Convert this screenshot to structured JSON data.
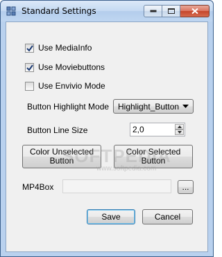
{
  "window": {
    "title": "Standard Settings",
    "title_bar_color": "#c4d9f2",
    "close_button_color": "#c4442a"
  },
  "options": {
    "use_mediainfo": {
      "label": "Use MediaInfo",
      "checked": true
    },
    "use_moviebuttons": {
      "label": "Use Moviebuttons",
      "checked": true
    },
    "use_envivio_mode": {
      "label": "Use Envivio Mode",
      "checked": false
    }
  },
  "highlight_mode": {
    "label": "Button Highlight Mode",
    "value": "Highlight_Button"
  },
  "line_size": {
    "label": "Button Line Size",
    "value": "2,0"
  },
  "color_buttons": {
    "unselected": "Color Unselected Button",
    "selected": "Color Selected Button"
  },
  "mp4box": {
    "label": "MP4Box",
    "value": "",
    "browse_label": "..."
  },
  "actions": {
    "save": "Save",
    "cancel": "Cancel"
  },
  "watermark": {
    "big": "SOFTPEDIA",
    "small": "www.softpedia.com"
  }
}
